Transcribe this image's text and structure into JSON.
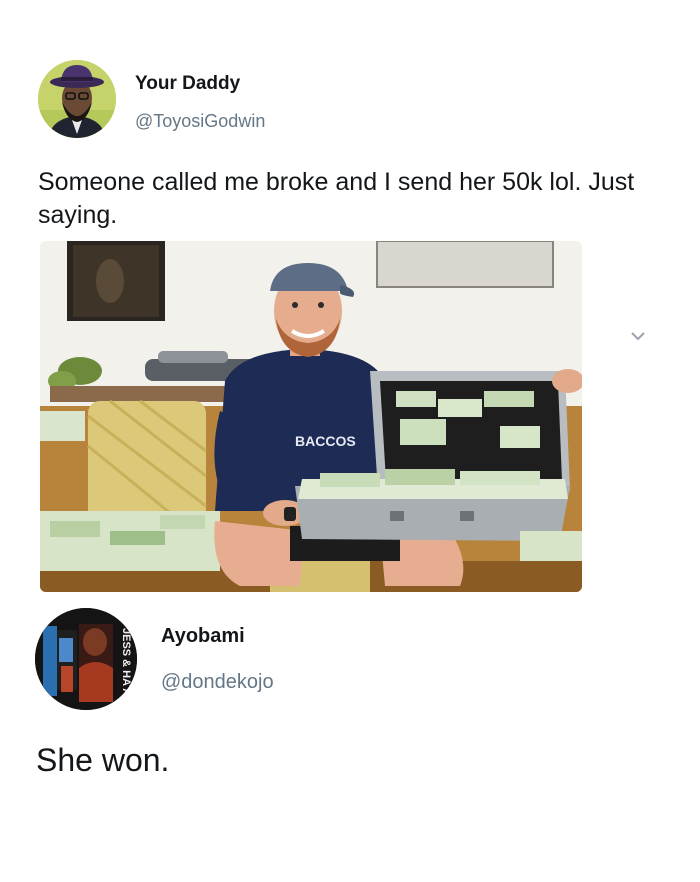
{
  "tweet1": {
    "name": "Your Daddy",
    "handle": "@ToyosiGodwin",
    "text": "Someone called me broke and I send her 50k lol. Just saying.",
    "media": {
      "shirt_text": "BACCOS"
    }
  },
  "tweet2": {
    "name": "Ayobami",
    "handle": "@dondekojo",
    "text": "She won.",
    "avatar_text": "JESS & HA ALL"
  },
  "icons": {
    "expand": "chevron-down-icon"
  },
  "colors": {
    "name": "#14171a",
    "handle": "#657786",
    "avatar1_bg": "#c8d46a",
    "avatar2_bg": "#151515",
    "sweater": "#1d2b55",
    "case": "#9ea3a8",
    "money": "#cfe0c0"
  }
}
